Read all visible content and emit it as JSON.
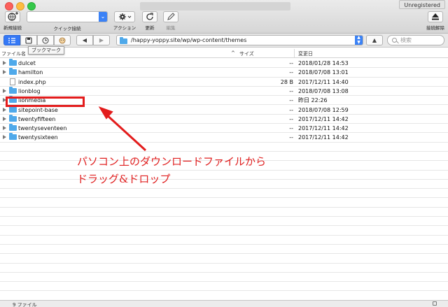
{
  "app": {
    "registration_badge": "Unregistered"
  },
  "toolbar": {
    "new_connection_label": "新規接続",
    "quick_connect_label": "クイック接続",
    "action_label": "アクション",
    "refresh_label": "更新",
    "edit_label": "編集",
    "disconnect_label": "接続解除"
  },
  "navbar": {
    "tooltip": "ブックマーク",
    "path": "/happy-yoppy.site/wp/wp-content/themes",
    "search_placeholder": "検索"
  },
  "columns": {
    "name": "ファイル名",
    "size": "サイズ",
    "modified": "変更日"
  },
  "files": [
    {
      "name": "dulcet",
      "kind": "folder",
      "size": "--",
      "modified": "2018/01/28 14:53"
    },
    {
      "name": "hamilton",
      "kind": "folder",
      "size": "--",
      "modified": "2018/07/08 13:01"
    },
    {
      "name": "index.php",
      "kind": "file",
      "size": "28 B",
      "modified": "2017/12/11 14:40"
    },
    {
      "name": "lionblog",
      "kind": "folder",
      "size": "--",
      "modified": "2018/07/08 13:08"
    },
    {
      "name": "lionmedia",
      "kind": "folder",
      "size": "--",
      "modified": "昨日 22:26"
    },
    {
      "name": "sitepoint-base",
      "kind": "folder",
      "size": "--",
      "modified": "2018/07/08 12:59"
    },
    {
      "name": "twentyfifteen",
      "kind": "folder",
      "size": "--",
      "modified": "2017/12/11 14:42"
    },
    {
      "name": "twentyseventeen",
      "kind": "folder",
      "size": "--",
      "modified": "2017/12/11 14:42"
    },
    {
      "name": "twentysixteen",
      "kind": "folder",
      "size": "--",
      "modified": "2017/12/11 14:42"
    }
  ],
  "annotation": {
    "line1": "パソコン上のダウンロードファイルから",
    "line2": "ドラッグ&ドロップ",
    "color": "#e31c1c"
  },
  "status": {
    "count": "9 ファイル"
  }
}
